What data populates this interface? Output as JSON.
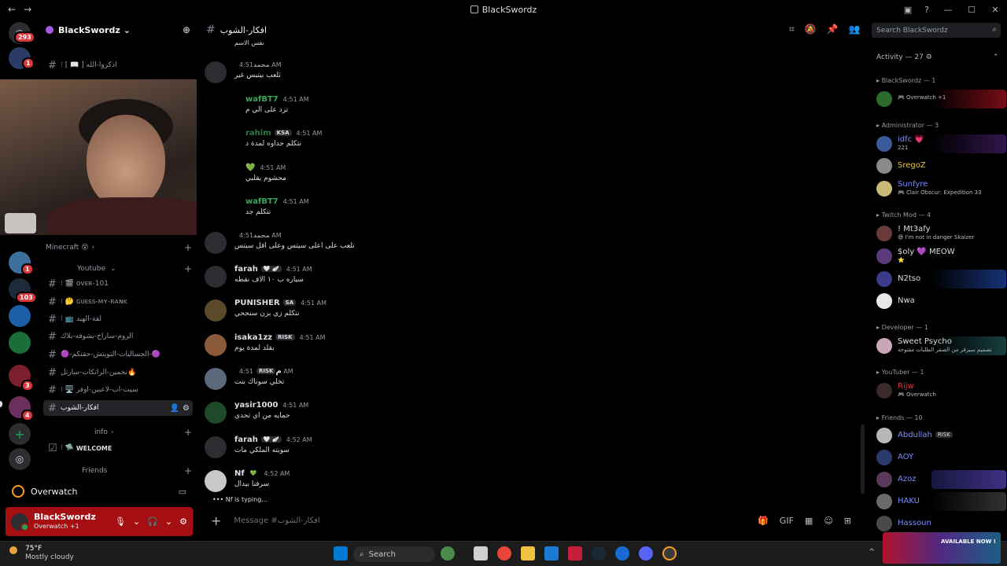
{
  "window": {
    "title": "BlackSwordz",
    "nav_back": "←",
    "nav_forward": "→"
  },
  "guilds": {
    "home_badge": "293",
    "badges": [
      "1",
      "1",
      "103",
      "3",
      "4"
    ]
  },
  "server": {
    "name": "BlackSwordz",
    "chevron": "⌄",
    "channels_top": [
      {
        "prefix": "⁝ [ 📖 ]",
        "name": "اذكروا-الله"
      }
    ],
    "categories": {
      "minecraft": "Minecraft 😵",
      "youtube": "Youtube",
      "info": "info",
      "friends": "Friends"
    },
    "channels": [
      {
        "name": "ᴏᴠᴇʀ-101",
        "prefix": "⁝ 🎬"
      },
      {
        "name": "ɢᴜᴇss-ᴍʏ-ʀᴀɴᴋ",
        "prefix": "⁝ 🤔"
      },
      {
        "name": "لقة-الهيد",
        "prefix": "⁝ 📺"
      },
      {
        "name": "الروم-ساراح-بشوفه-بلاك",
        "prefix": ""
      },
      {
        "name": "🟣-الحساليات-التويتش-حقتكم-🟣",
        "prefix": ""
      },
      {
        "name": "تخمين-الراتكات-سارتل🔥",
        "prefix": ""
      },
      {
        "name": "سيت-اب-لاعبين-اوفر",
        "prefix": "⁝ 🖥️"
      },
      {
        "name": "افكار-الشوب",
        "prefix": ""
      }
    ],
    "info_channels": [
      {
        "name": "WELCOME",
        "prefix": "⁝ 🛸"
      }
    ]
  },
  "activity_bar": {
    "game": "Overwatch"
  },
  "user": {
    "name": "BlackSwordz",
    "status": "Overwatch +1"
  },
  "chat": {
    "channel": "افكار-الشوب",
    "top_cut": "نفس الاسم",
    "messages": [
      {
        "author": "محمد",
        "color": "#949ba4",
        "time": "4:51 AM",
        "text": "ثلعب بيتيس غير",
        "tag": ""
      },
      {
        "author": "wafBT7",
        "color": "#3ba55c",
        "time": "4:51 AM",
        "text": "ترد على الي م",
        "tag": ""
      },
      {
        "author": "rahim",
        "color": "#3ba55c",
        "time": "4:51 AM",
        "text": "نتكلم جداوه لمدة د",
        "tag": "KSA"
      },
      {
        "author": "",
        "color": "#dbdee1",
        "time": "4:51 AM",
        "text": "محشوم يقلبي",
        "tag": ""
      },
      {
        "author": "wafBT7",
        "color": "#3ba55c",
        "time": "4:51 AM",
        "text": "نتكلم جد",
        "tag": ""
      },
      {
        "author": "محمد",
        "color": "#949ba4",
        "time": "4:51 AM",
        "text": "تلعب على اعلى سيتس وعلى اقل سيتس",
        "tag": ""
      },
      {
        "author": "farah",
        "color": "#dbdee1",
        "time": "4:51 AM",
        "text": "سياره ب ١٠ الاف نقطه",
        "tag": "🤍 🪽"
      },
      {
        "author": "PUNISHER",
        "color": "#dbdee1",
        "time": "4:51 AM",
        "text": "نتكلم زي بزن سنجحي",
        "tag": "SA"
      },
      {
        "author": "isaka1zz",
        "color": "#dbdee1",
        "time": "4:51 AM",
        "text": "بقلد لمدة يوم",
        "tag": "RISK"
      },
      {
        "author": "م",
        "color": "#dbdee1",
        "time": "4:51 AM",
        "text": "تخلي سوناك بنت",
        "tag": "RISK"
      },
      {
        "author": "yasir1000",
        "color": "#dbdee1",
        "time": "4:51 AM",
        "text": "حمايه من اي تحدي",
        "tag": ""
      },
      {
        "author": "farah",
        "color": "#dbdee1",
        "time": "4:52 AM",
        "text": "سويته الملكي مات",
        "tag": "🤍 🪽"
      },
      {
        "author": "Nf",
        "color": "#dbdee1",
        "time": "4:52 AM",
        "text": "سرفنا بيدال",
        "tag": "💚"
      }
    ],
    "typing": "Nf is typing...",
    "composer_placeholder": "Message #افكار-الشوب"
  },
  "search": {
    "placeholder": "Search BlackSwordz"
  },
  "members": {
    "activity_header": "Activity — 27",
    "groups": [
      {
        "title": "BlackSwordz — 1",
        "items": [
          {
            "name": "",
            "status": "🎮 Overwatch +1",
            "color": "#dbdee1"
          }
        ]
      },
      {
        "title": "Administrator — 3",
        "items": [
          {
            "name": "idfc 💗",
            "status": "221",
            "color": "#7c8cff"
          },
          {
            "name": "SregoZ",
            "status": "",
            "color": "#e8c84b"
          },
          {
            "name": "Sunfyre",
            "status": "🎮 Clair Obscur: Expedition 33",
            "color": "#7c8cff"
          }
        ]
      },
      {
        "title": "Twitch Mod — 4",
        "items": [
          {
            "name": "! Mt3afy",
            "status": "😅 I'm not in danger Skaizer",
            "color": "#f2f3f5"
          },
          {
            "name": "$oly 💜 MEOW",
            "status": "⭐",
            "color": "#f2f3f5"
          },
          {
            "name": "N2tso",
            "status": "",
            "color": "#f2f3f5"
          },
          {
            "name": "Nwa",
            "status": "",
            "color": "#f2f3f5"
          }
        ]
      },
      {
        "title": "Developer — 1",
        "items": [
          {
            "name": "Sweet Psycho",
            "status": "تصميم سيرفر من الصفر الطلبات مفتوحة",
            "color": "#f2f3f5"
          }
        ]
      },
      {
        "title": "YouTuber — 1",
        "items": [
          {
            "name": "Rijw",
            "status": "🎮 Overwatch",
            "color": "#da373c"
          }
        ]
      },
      {
        "title": "Friends — 10",
        "items": [
          {
            "name": "Abdullah",
            "status": "",
            "color": "#7c8cff",
            "tag": "RISK"
          },
          {
            "name": "AOY",
            "status": "",
            "color": "#7c8cff"
          },
          {
            "name": "Azoz",
            "status": "",
            "color": "#7c8cff"
          },
          {
            "name": "HAKU",
            "status": "",
            "color": "#7c8cff"
          },
          {
            "name": "Hassoun",
            "status": "",
            "color": "#7c8cff"
          }
        ]
      }
    ]
  },
  "taskbar": {
    "temp": "75°F",
    "weather": "Mostly cloudy",
    "search": "Search",
    "tray_chevron": "^",
    "ad_text": "AVAILABLE NOW !"
  }
}
